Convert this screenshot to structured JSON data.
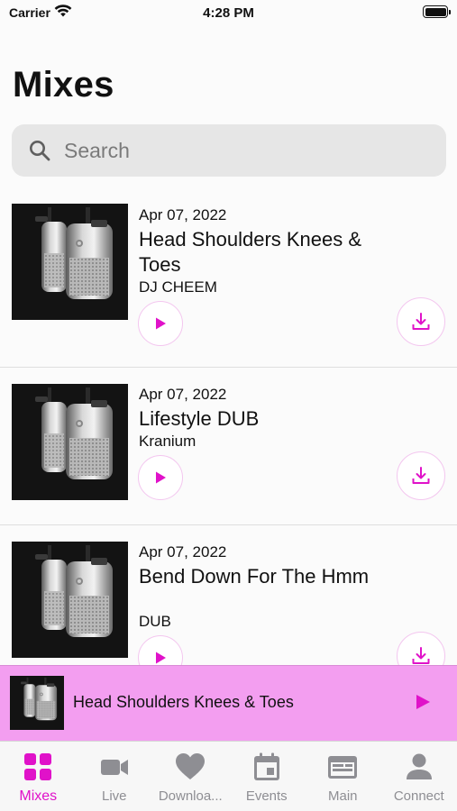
{
  "status_bar": {
    "carrier": "Carrier",
    "time": "4:28 PM"
  },
  "page": {
    "title": "Mixes"
  },
  "search": {
    "placeholder": "Search",
    "value": ""
  },
  "mixes": [
    {
      "date": "Apr 07, 2022",
      "title": "Head Shoulders Knees & Toes",
      "artist": "DJ CHEEM"
    },
    {
      "date": "Apr 07, 2022",
      "title": "Lifestyle DUB",
      "artist": "Kranium"
    },
    {
      "date": "Apr 07, 2022",
      "title": "Bend Down For The Hmm",
      "artist": "DUB"
    }
  ],
  "now_playing": {
    "title": "Head Shoulders Knees & Toes"
  },
  "tabs": [
    {
      "label": "Mixes",
      "icon": "grid-icon",
      "active": true
    },
    {
      "label": "Live",
      "icon": "video-camera-icon",
      "active": false
    },
    {
      "label": "Downloa...",
      "icon": "heart-icon",
      "active": false
    },
    {
      "label": "Events",
      "icon": "calendar-icon",
      "active": false
    },
    {
      "label": "Main",
      "icon": "browser-window-icon",
      "active": false
    },
    {
      "label": "Connect",
      "icon": "person-icon",
      "active": false
    }
  ],
  "colors": {
    "accent": "#e012c9",
    "now_playing_bg": "#f39ef0",
    "inactive_tab": "#8e8e93",
    "search_bg": "#e6e6e6"
  }
}
